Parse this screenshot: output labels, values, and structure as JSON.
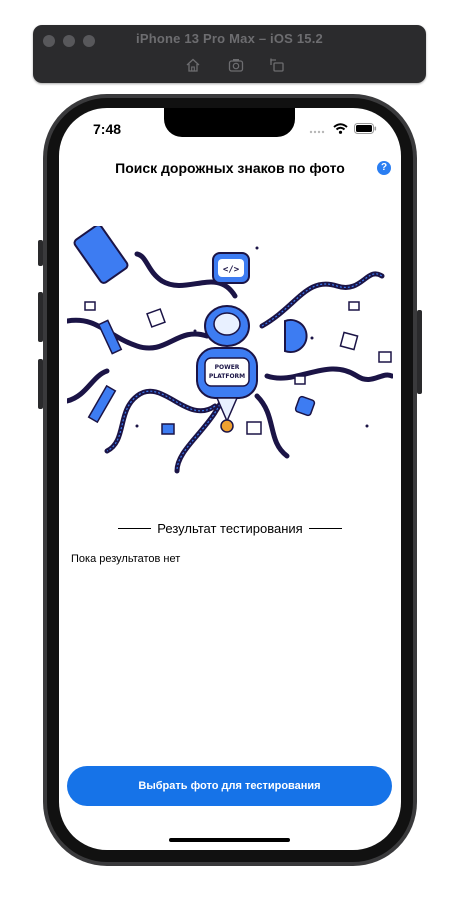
{
  "simulator": {
    "title": "iPhone 13 Pro Max – iOS 15.2",
    "toolbar_icons": [
      "home-icon",
      "screenshot-icon",
      "rotate-icon"
    ]
  },
  "status_bar": {
    "time": "7:48",
    "icons": [
      "signal-icon",
      "wifi-icon",
      "battery-icon"
    ]
  },
  "nav": {
    "title": "Поиск дорожных знаков по фото",
    "help_label": "?"
  },
  "illustration": {
    "robot_label_line1": "POWER",
    "robot_label_line2": "PLATFORM",
    "chat_bubble_text": "</>"
  },
  "results": {
    "header": "Результат тестирования",
    "empty_text": "Пока результатов нет"
  },
  "actions": {
    "select_photo_label": "Выбрать фото для тестирования"
  },
  "colors": {
    "accent": "#1673e8",
    "help_icon": "#2a7ef2",
    "illustration_dark": "#1b1446",
    "illustration_blue": "#3d7cf2"
  }
}
